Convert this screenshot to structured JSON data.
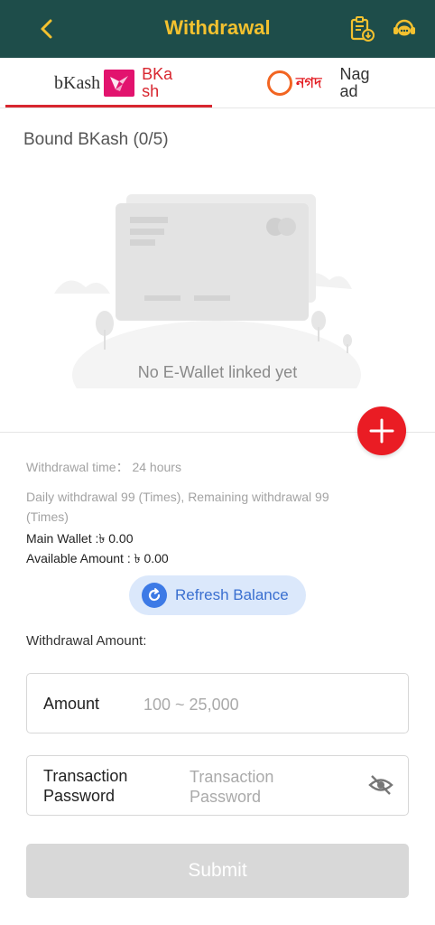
{
  "header": {
    "title": "Withdrawal",
    "back_icon": "chevron-left-icon",
    "history_icon": "clipboard-download-icon",
    "support_icon": "customer-service-icon",
    "bg_color": "#1e4d4a",
    "title_color": "#f3c12f"
  },
  "tabs": [
    {
      "logo_text": "bKash",
      "label": "BKash",
      "active": true,
      "accent": "#d8262f"
    },
    {
      "logo_text": "নগদ",
      "label": "Nagad",
      "active": false
    }
  ],
  "bound": {
    "title": "Bound BKash (0/5)"
  },
  "empty_state": {
    "message": "No E-Wallet linked yet"
  },
  "info": {
    "withdrawal_time": "Withdrawal time： 24 hours",
    "daily_line1": "Daily withdrawal 99 (Times), Remaining withdrawal 99",
    "daily_line2": "(Times)",
    "main_wallet": "Main Wallet :৳ 0.00",
    "available_amount": "Available Amount : ৳ 0.00"
  },
  "refresh": {
    "label": "Refresh Balance"
  },
  "form": {
    "amount_section_label": "Withdrawal Amount:",
    "amount_label": "Amount",
    "amount_placeholder": "100 ~ 25,000",
    "password_label_line1": "Transaction",
    "password_label_line2": "Password",
    "password_placeholder_line1": "Transaction",
    "password_placeholder_line2": "Password",
    "submit_label": "Submit"
  }
}
